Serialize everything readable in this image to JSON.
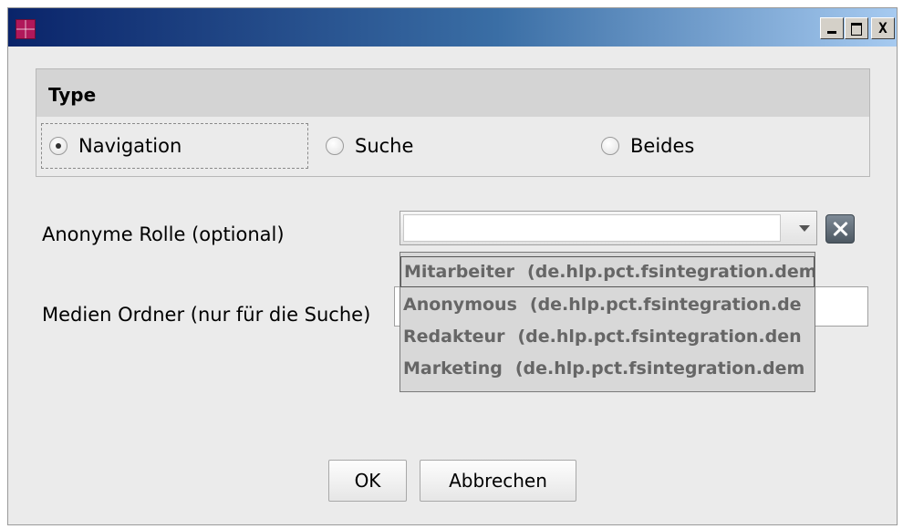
{
  "window": {
    "minimize": "_",
    "maximize": "□",
    "close": "X"
  },
  "type_group": {
    "title": "Type",
    "options": [
      {
        "label": "Navigation",
        "checked": true
      },
      {
        "label": "Suche",
        "checked": false
      },
      {
        "label": "Beides",
        "checked": false
      }
    ]
  },
  "form": {
    "anonyme_rolle_label": "Anonyme Rolle (optional)",
    "anonyme_rolle_value": "",
    "medien_ordner_label": "Medien Ordner (nur für die Suche)",
    "medien_ordner_value": ""
  },
  "dropdown": {
    "items": [
      {
        "role": "Mitarbeiter",
        "path": "(de.hlp.pct.fsintegration.dem"
      },
      {
        "role": "Anonymous",
        "path": "(de.hlp.pct.fsintegration.de"
      },
      {
        "role": "Redakteur",
        "path": "(de.hlp.pct.fsintegration.den"
      },
      {
        "role": "Marketing",
        "path": "(de.hlp.pct.fsintegration.dem"
      }
    ]
  },
  "buttons": {
    "ok": "OK",
    "cancel": "Abbrechen"
  },
  "colors": {
    "titlebar_start": "#0a246a",
    "titlebar_end": "#a6caf0",
    "app_icon": "#b0185a"
  }
}
